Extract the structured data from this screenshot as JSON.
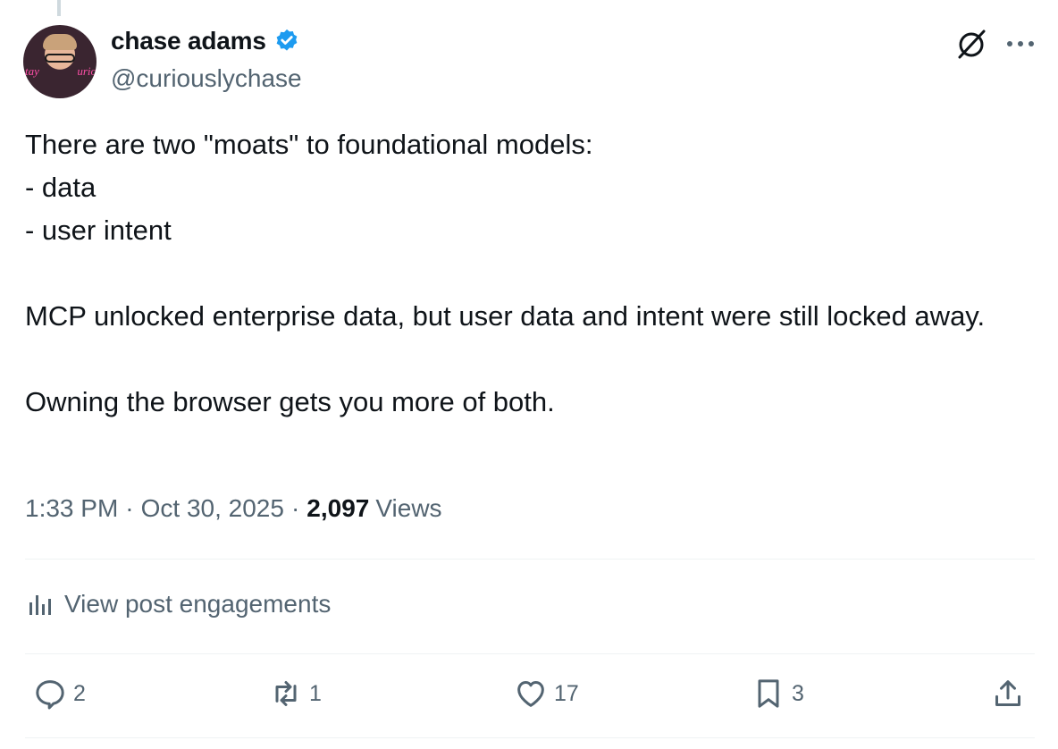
{
  "author": {
    "display_name": "chase adams",
    "handle": "@curiouslychase",
    "verified": true,
    "avatar_neon_left": "tay",
    "avatar_neon_right": "urio"
  },
  "tweet": {
    "paragraphs": [
      "There are two \"moats\" to foundational models:\n- data\n- user intent",
      "MCP unlocked enterprise data, but user data and intent were still locked away.",
      "Owning the browser gets you more of both."
    ]
  },
  "meta": {
    "time": "1:33 PM",
    "separator": "·",
    "date": "Oct 30, 2025",
    "views_count": "2,097",
    "views_label": "Views"
  },
  "engagements": {
    "label": "View post engagements"
  },
  "actions": {
    "reply_count": "2",
    "repost_count": "1",
    "like_count": "17",
    "bookmark_count": "3"
  },
  "colors": {
    "text": "#0f1419",
    "secondary": "#536471",
    "verified": "#1d9bf0",
    "divider": "#eff3f4"
  },
  "icons": [
    "verified-badge-icon",
    "grok-icon",
    "more-icon",
    "analytics-icon",
    "reply-icon",
    "repost-icon",
    "like-icon",
    "bookmark-icon",
    "share-icon"
  ]
}
